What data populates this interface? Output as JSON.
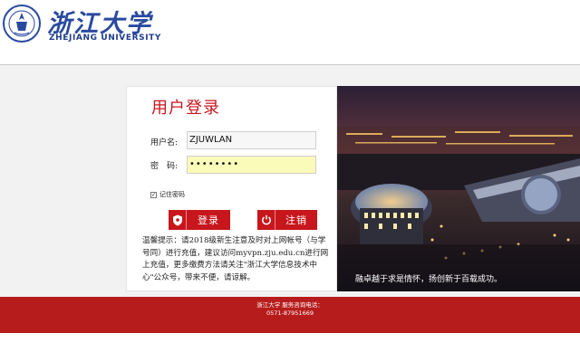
{
  "header": {
    "brand_cn": "浙江大学",
    "brand_en": "ZHEJIANG UNIVERSITY",
    "logo_icon": "university-seal-icon"
  },
  "login": {
    "title": "用户登录",
    "username_label": "用户名:",
    "username_value": "ZJUWLAN",
    "password_label": "密　码:",
    "password_value": "••••••••",
    "remember_label": "记住密码",
    "remember_checked": true,
    "login_button": "登录",
    "logout_button": "注销",
    "notice": "温馨提示：请2018级新生注意及时对上网帐号（与学号同）进行充值，建议访问myvpn.zju.edu.cn进行网上充值，更多缴费方法请关注\"浙江大学信息技术中心\"公众号，带来不便，请谅解。"
  },
  "photo": {
    "caption": "融卓越于求是情怀，扬创新于百载成功。"
  },
  "footer": {
    "line1": "浙江大学  服务咨询电话：",
    "line2": "0571-87951669"
  },
  "colors": {
    "accent": "#c8161d",
    "footer": "#b71c1c",
    "brand": "#2a4aa0"
  }
}
